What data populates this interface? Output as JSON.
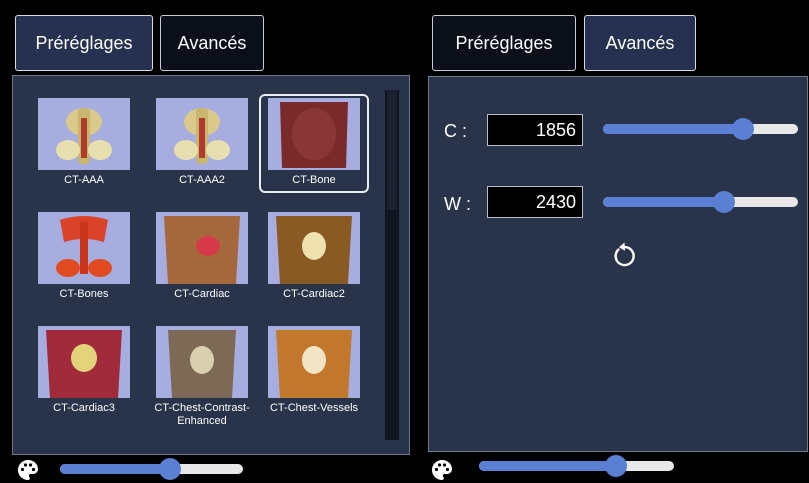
{
  "left_panel": {
    "tabs": [
      {
        "label": "Préréglages",
        "active": true
      },
      {
        "label": "Avancés",
        "active": false
      }
    ],
    "presets": [
      {
        "label": "CT-AAA",
        "selected": false,
        "style": "vessels"
      },
      {
        "label": "CT-AAA2",
        "selected": false,
        "style": "vessels"
      },
      {
        "label": "CT-Bone",
        "selected": true,
        "style": "skin"
      },
      {
        "label": "CT-Bones",
        "selected": false,
        "style": "bones"
      },
      {
        "label": "CT-Cardiac",
        "selected": false,
        "style": "cardiac"
      },
      {
        "label": "CT-Cardiac2",
        "selected": false,
        "style": "cardiac2"
      },
      {
        "label": "CT-Cardiac3",
        "selected": false,
        "style": "cardiac3"
      },
      {
        "label": "CT-Chest-Contrast-Enhanced",
        "selected": false,
        "style": "chest"
      },
      {
        "label": "CT-Chest-Vessels",
        "selected": false,
        "style": "chestvessels"
      }
    ],
    "opacity_slider": {
      "value": 0.6
    }
  },
  "right_panel": {
    "tabs": [
      {
        "label": "Préréglages",
        "active": false
      },
      {
        "label": "Avancés",
        "active": true
      }
    ],
    "center": {
      "label": "C :",
      "value": "1856",
      "slider_value": 0.72
    },
    "width": {
      "label": "W :",
      "value": "2430",
      "slider_value": 0.62
    },
    "opacity_slider": {
      "value": 0.7
    }
  },
  "icons": {
    "palette": "palette-icon",
    "reset": "reset-icon"
  },
  "colors": {
    "accent": "#5b7fd3",
    "panel_bg": "#293349",
    "thumb_bg": "#a7adde"
  }
}
